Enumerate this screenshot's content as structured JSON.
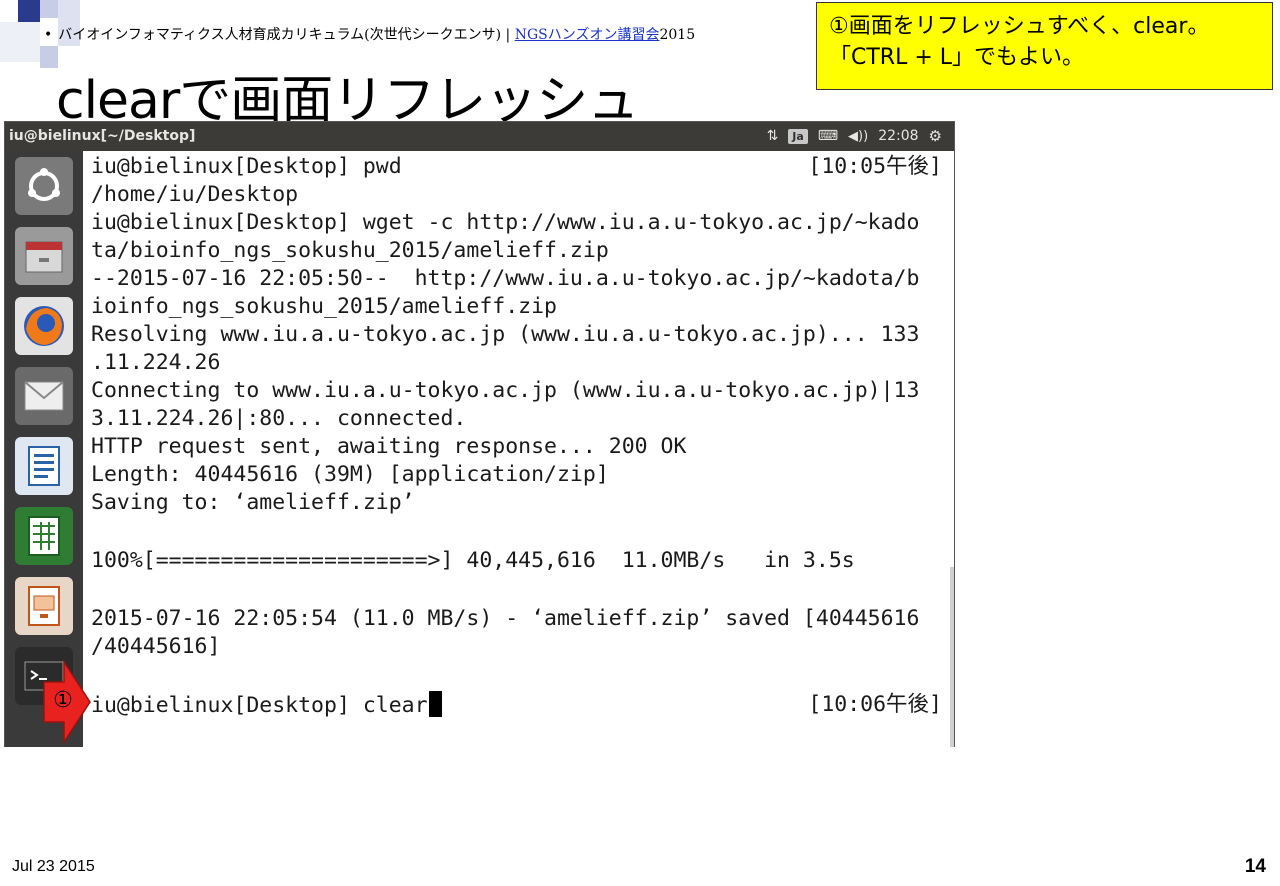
{
  "slide": {
    "bullet": "•",
    "breadcrumb_text": "バイオインフォマティクス人材育成カリキュラム(次世代シークエンサ) | ",
    "breadcrumb_link": "NGSハンズオン講習会",
    "breadcrumb_year": "2015",
    "title": "clearで画面リフレッシュ",
    "callout_line1": "①画面をリフレッシュすべく、clear。",
    "callout_line2": "「CTRL + L」でもよい。",
    "arrow_label": "①",
    "footer_date": "Jul 23 2015",
    "page_number": "14"
  },
  "window": {
    "title": "iu@bielinux[~/Desktop]",
    "indicators": {
      "network": "⇅",
      "input_method": "Ja",
      "keyboard": "⌨",
      "volume": "◀))",
      "clock": "22:08",
      "settings": "⚙"
    }
  },
  "launcher": {
    "items": [
      "ubuntu-dash",
      "files",
      "firefox",
      "mail",
      "writer",
      "calc",
      "impress",
      "terminal"
    ]
  },
  "terminal": {
    "lines": [
      "iu@bielinux[Desktop] pwd",
      "/home/iu/Desktop",
      "iu@bielinux[Desktop] wget -c http://www.iu.a.u-tokyo.ac.jp/~kado",
      "ta/bioinfo_ngs_sokushu_2015/amelieff.zip",
      "--2015-07-16 22:05:50--  http://www.iu.a.u-tokyo.ac.jp/~kadota/b",
      "ioinfo_ngs_sokushu_2015/amelieff.zip",
      "Resolving www.iu.a.u-tokyo.ac.jp (www.iu.a.u-tokyo.ac.jp)... 133",
      ".11.224.26",
      "Connecting to www.iu.a.u-tokyo.ac.jp (www.iu.a.u-tokyo.ac.jp)|13",
      "3.11.224.26|:80... connected.",
      "HTTP request sent, awaiting response... 200 OK",
      "Length: 40445616 (39M) [application/zip]",
      "Saving to: ‘amelieff.zip’",
      "",
      "100%[=====================>] 40,445,616  11.0MB/s   in 3.5s",
      "",
      "2015-07-16 22:05:54 (11.0 MB/s) - ‘amelieff.zip’ saved [40445616",
      "/40445616]",
      "",
      "iu@bielinux[Desktop] clear"
    ],
    "time_first": "[10:05午後]",
    "time_last": "[10:06午後]"
  },
  "colors": {
    "callout_bg": "#ffff00",
    "titlebar_bg": "#3c3b37",
    "arrow_red": "#e8231f",
    "link_blue": "#1a33c8"
  }
}
